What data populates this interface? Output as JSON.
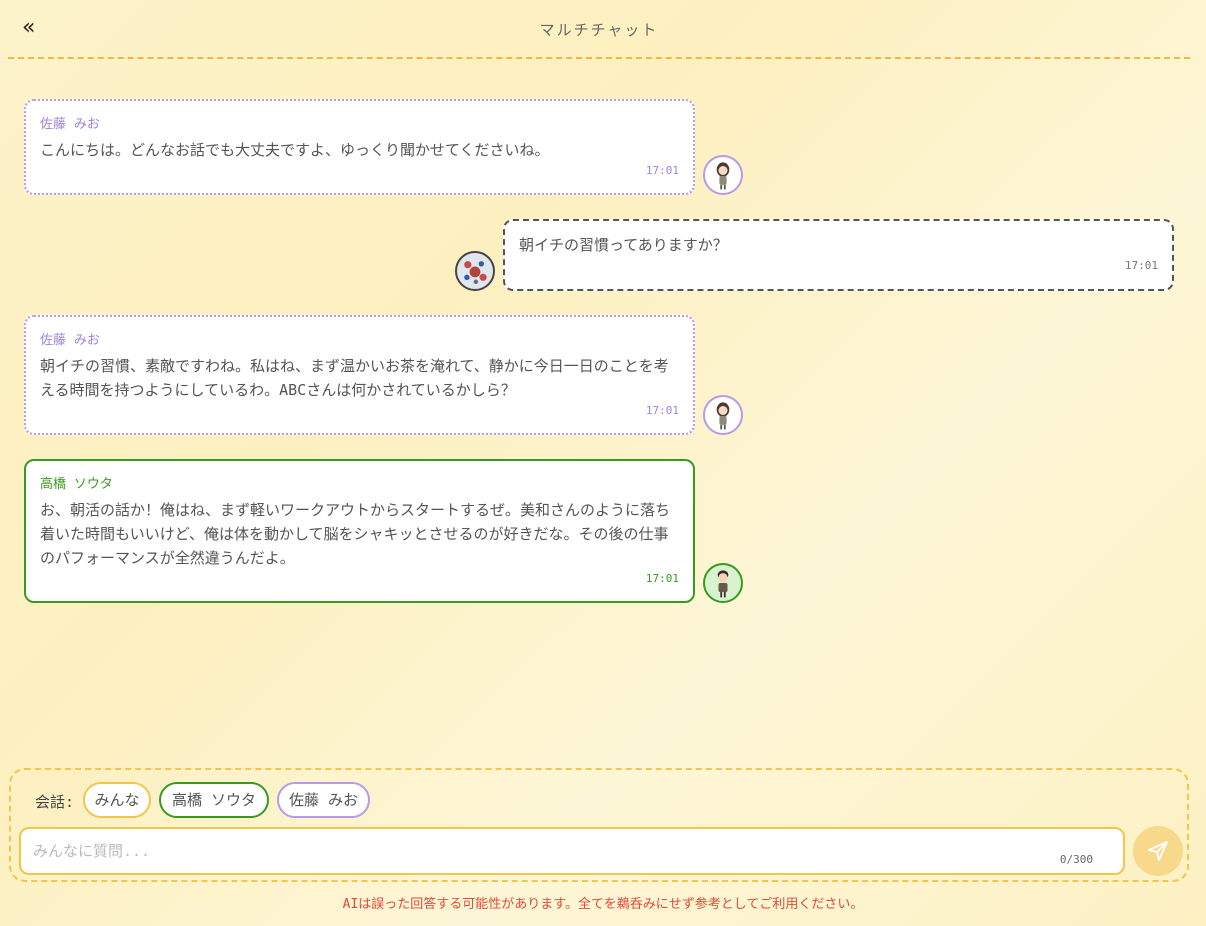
{
  "header": {
    "back_label": "«",
    "title": "マルチチャット"
  },
  "messages": [
    {
      "sender": "佐藤 みお",
      "text": "こんにちは。どんなお話でも大丈夫ですよ、ゆっくり聞かせてくださいね。",
      "time": "17:01"
    },
    {
      "sender": "",
      "text": "朝イチの習慣ってありますか？",
      "time": "17:01"
    },
    {
      "sender": "佐藤 みお",
      "text": "朝イチの習慣、素敵ですわね。私はね、まず温かいお茶を淹れて、静かに今日一日のことを考える時間を持つようにしているわ。ABCさんは何かされているかしら？",
      "time": "17:01"
    },
    {
      "sender": "高橋 ソウタ",
      "text": "お、朝活の話か！俺はね、まず軽いワークアウトからスタートするぜ。美和さんのように落ち着いた時間もいいけど、俺は体を動かして脳をシャキッとさせるのが好きだな。その後の仕事のパフォーマンスが全然違うんだよ。",
      "time": "17:01"
    }
  ],
  "composer": {
    "conversation_label": "会話:",
    "chips": [
      "みんな",
      "高橋 ソウタ",
      "佐藤 みお"
    ],
    "placeholder": "みんなに質問...",
    "char_count": "0/300"
  },
  "disclaimer": "AIは誤った回答する可能性があります。全てを鵜呑みにせず参考としてご利用ください。",
  "colors": {
    "accent_yellow": "#f5c44a",
    "mio_purple": "#b59be8",
    "sota_green": "#3a9a1c",
    "warning_red": "#e04a3a"
  },
  "icons": {
    "back": "double-chevron-left-icon",
    "send": "paper-plane-icon"
  }
}
